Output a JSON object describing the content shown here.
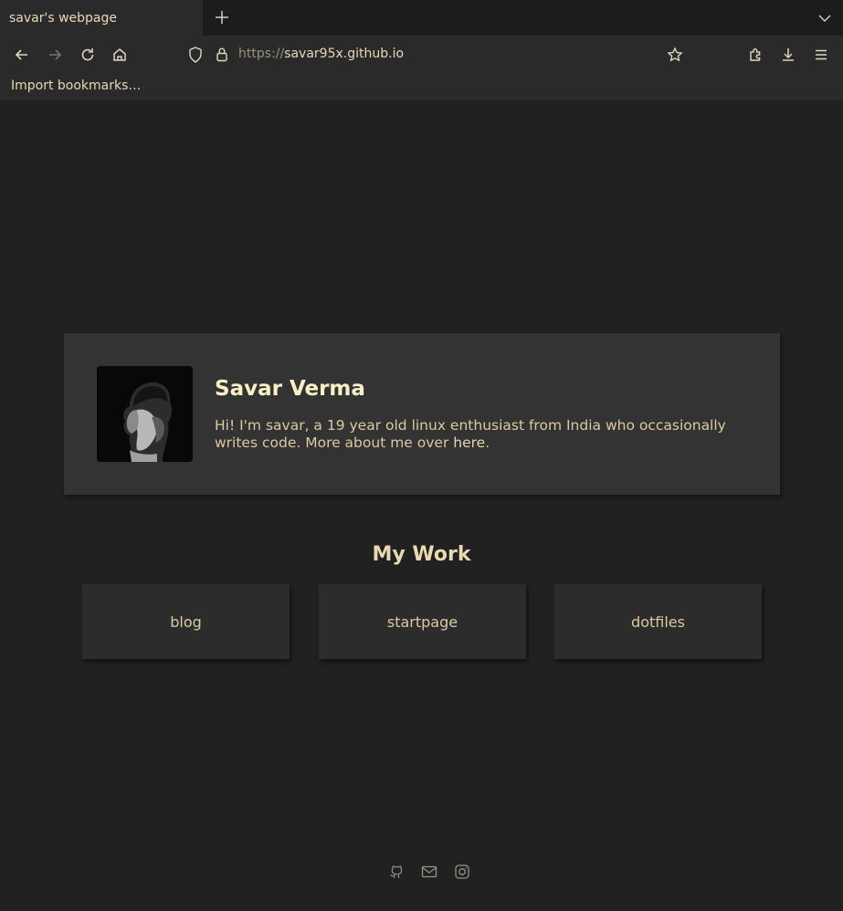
{
  "browser": {
    "tab_title": "savar's webpage",
    "url_scheme": "https://",
    "url_host": "savar95x.github.io",
    "bookmarks": [
      "Import bookmarks…"
    ]
  },
  "profile": {
    "name": "Savar Verma",
    "bio_text": "Hi! I'm savar, a 19 year old linux enthusiast from India who occasionally writes code. More about me over ",
    "bio_link": "here",
    "bio_end": "."
  },
  "work": {
    "title": "My Work",
    "items": [
      "blog",
      "startpage",
      "dotfiles"
    ]
  },
  "footer": {
    "icons": [
      "github-icon",
      "mail-icon",
      "instagram-icon"
    ]
  },
  "colors": {
    "background": "#212121",
    "card": "#333333",
    "accent_text": "#fbefc9"
  }
}
